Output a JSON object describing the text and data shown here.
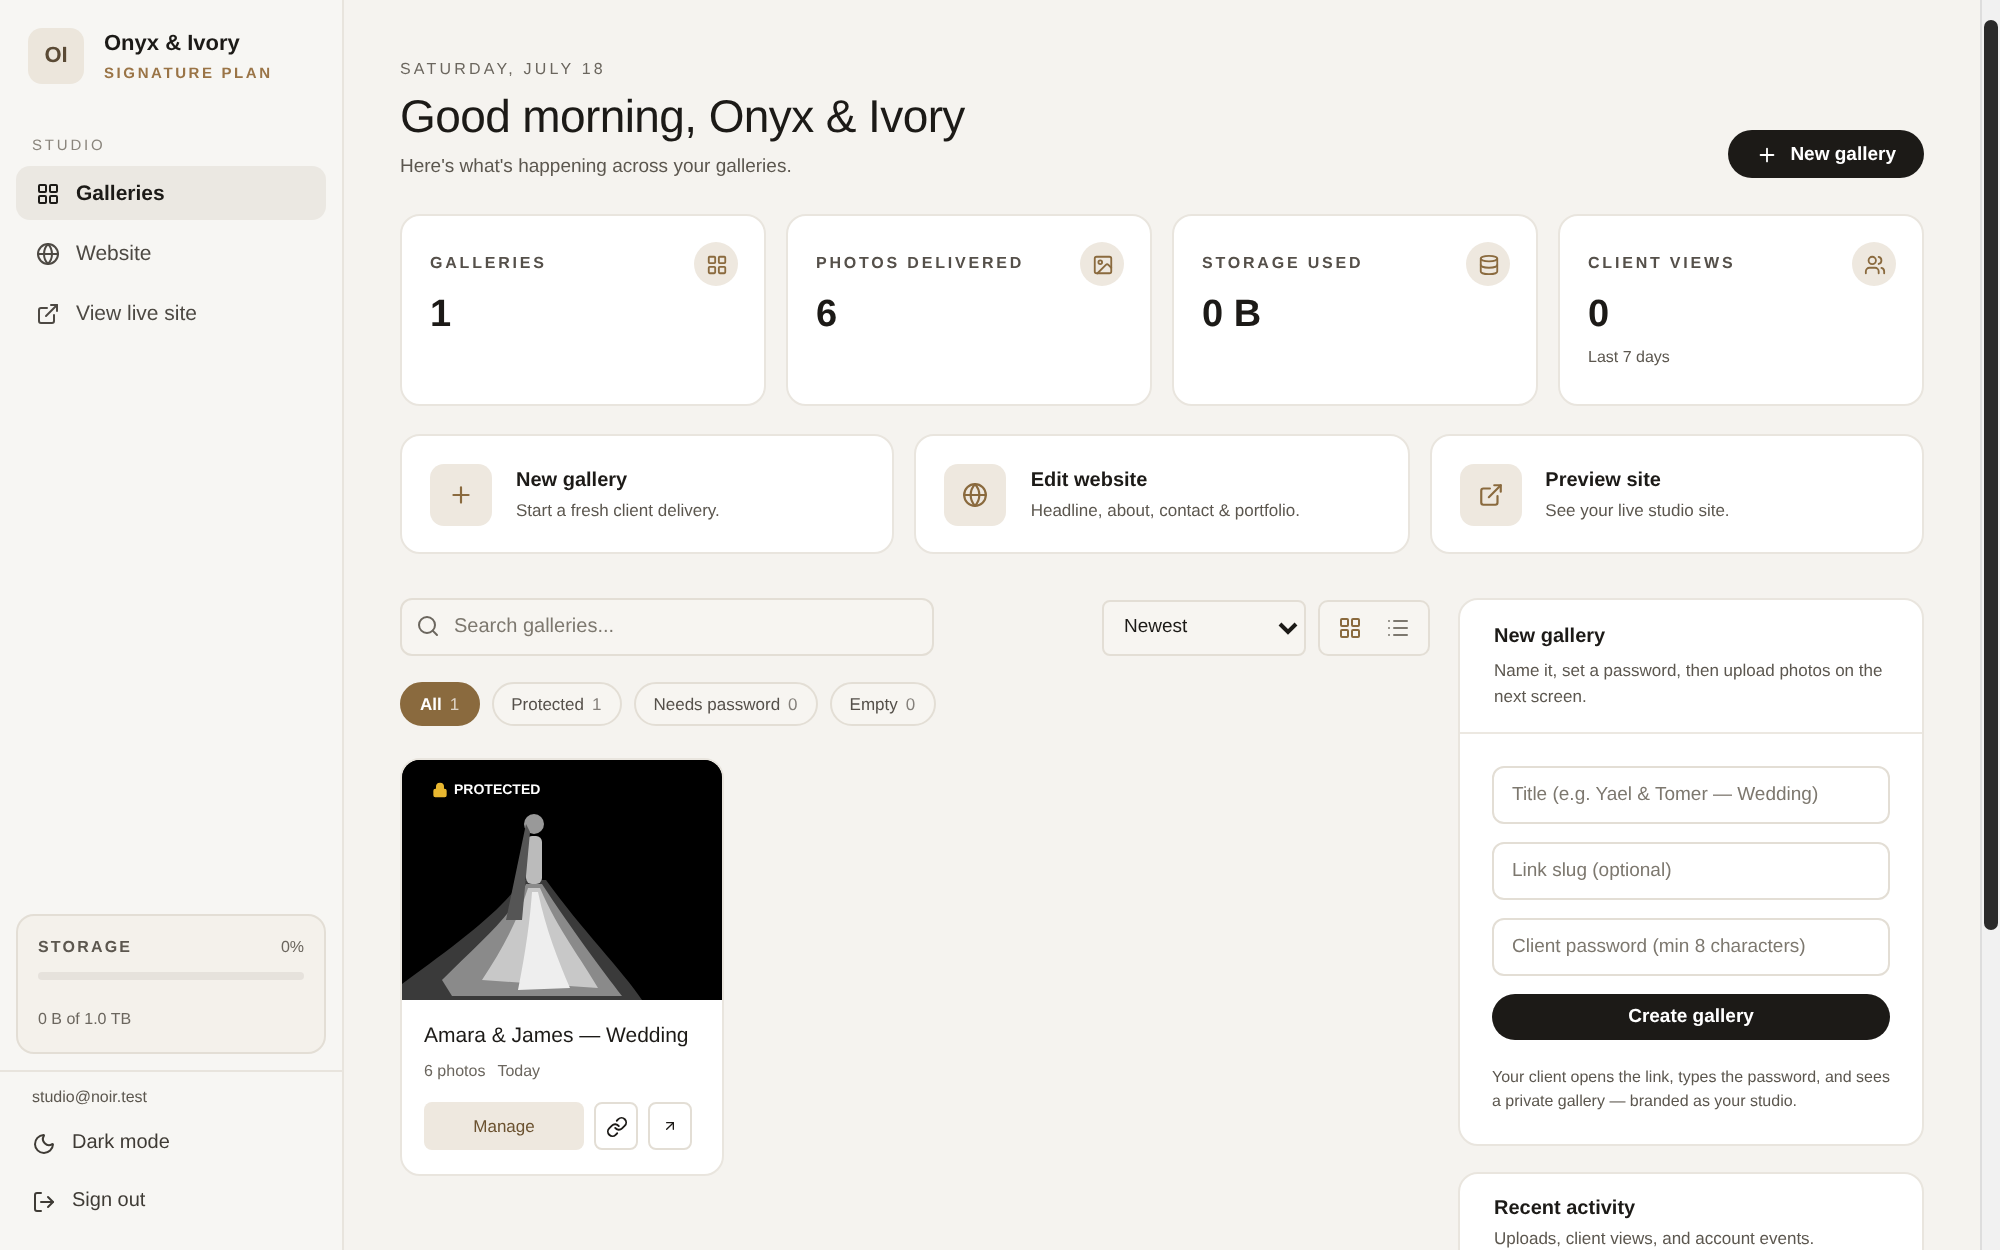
{
  "sidebar": {
    "avatar": "OI",
    "studio_name": "Onyx & Ivory",
    "plan": "SIGNATURE PLAN",
    "section": "STUDIO",
    "items": [
      {
        "label": "Galleries",
        "selected": true
      },
      {
        "label": "Website",
        "selected": false
      },
      {
        "label": "View live site",
        "selected": false
      }
    ],
    "storage": {
      "label": "STORAGE",
      "percent": "0%",
      "level": 0,
      "usage": "0 B of 1.0 TB"
    },
    "email": "studio@noir.test",
    "footer_items": [
      {
        "label": "Dark mode"
      },
      {
        "label": "Sign out"
      }
    ]
  },
  "header": {
    "date": "SATURDAY, JULY 18",
    "title": "Good morning, Onyx & Ivory",
    "subtitle": "Here's what's happening across your galleries.",
    "button": "New gallery"
  },
  "stats": [
    {
      "label": "GALLERIES",
      "value": "1"
    },
    {
      "label": "PHOTOS DELIVERED",
      "value": "6"
    },
    {
      "label": "STORAGE USED",
      "value": "0 B"
    },
    {
      "label": "CLIENT VIEWS",
      "value": "0",
      "note": "Last 7 days"
    }
  ],
  "quick_actions": [
    {
      "title": "New gallery",
      "description": "Start a fresh client delivery."
    },
    {
      "title": "Edit website",
      "description": "Headline, about, contact & portfolio."
    },
    {
      "title": "Preview site",
      "description": "See your live studio site."
    }
  ],
  "toolbar": {
    "search_placeholder": "Search galleries...",
    "sort": "Newest",
    "views": [
      {
        "kind": "grid",
        "selected": true
      },
      {
        "kind": "list",
        "selected": false
      }
    ]
  },
  "filters": [
    {
      "label": "All",
      "count": "1",
      "selected": true
    },
    {
      "label": "Protected",
      "count": "1",
      "selected": false
    },
    {
      "label": "Needs password",
      "count": "0",
      "selected": false
    },
    {
      "label": "Empty",
      "count": "0",
      "selected": false
    }
  ],
  "galleries": [
    {
      "badge": "PROTECTED",
      "title": "Amara & James — Wedding",
      "photos": "6 photos",
      "date": "Today",
      "button": "Manage"
    }
  ],
  "new_gallery_form": {
    "title": "New gallery",
    "description": "Name it, set a password, then upload photos on the next screen.",
    "fields": [
      {
        "placeholder": "Title (e.g. Yael & Tomer — Wedding)"
      },
      {
        "placeholder": "Link slug (optional)"
      },
      {
        "placeholder": "Client password (min 8 characters)"
      }
    ],
    "button": "Create gallery",
    "note": "Your client opens the link, types the password, and sees a private gallery — branded as your studio."
  },
  "recent_activity": {
    "title": "Recent activity",
    "description": "Uploads, client views, and account events."
  }
}
